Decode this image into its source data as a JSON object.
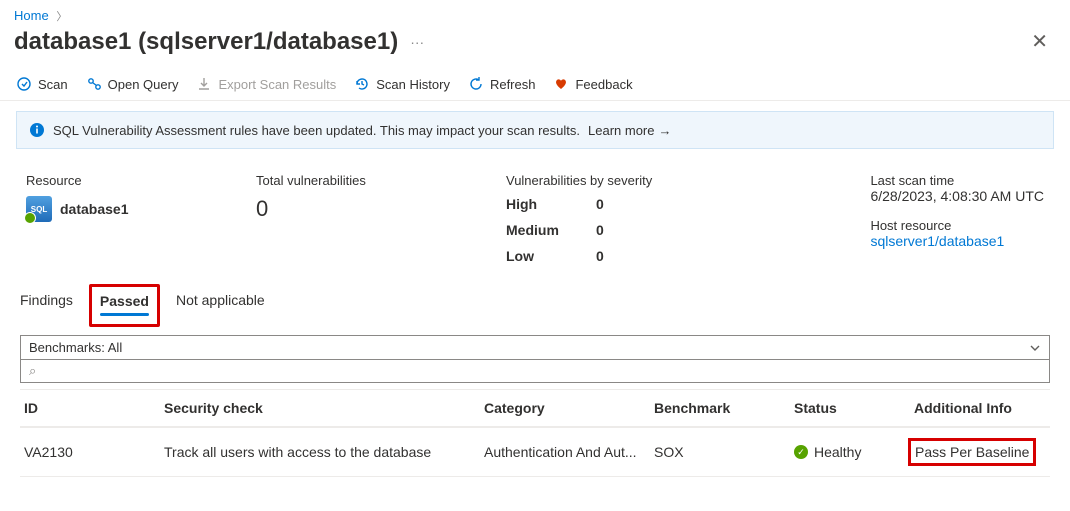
{
  "breadcrumb": {
    "home": "Home"
  },
  "title": "database1 (sqlserver1/database1)",
  "toolbar": {
    "scan": "Scan",
    "open_query": "Open Query",
    "export": "Export Scan Results",
    "history": "Scan History",
    "refresh": "Refresh",
    "feedback": "Feedback"
  },
  "info_bar": {
    "text": "SQL Vulnerability Assessment rules have been updated. This may impact your scan results.",
    "link": "Learn more"
  },
  "stats": {
    "resource_label": "Resource",
    "resource_name": "database1",
    "total_label": "Total vulnerabilities",
    "total_value": "0",
    "sev_label": "Vulnerabilities by severity",
    "high_k": "High",
    "high_v": "0",
    "med_k": "Medium",
    "med_v": "0",
    "low_k": "Low",
    "low_v": "0",
    "last_scan_label": "Last scan time",
    "last_scan_value": "6/28/2023, 4:08:30 AM UTC",
    "host_label": "Host resource",
    "host_value": "sqlserver1/database1"
  },
  "tabs": {
    "findings": "Findings",
    "passed": "Passed",
    "na": "Not applicable"
  },
  "filter": {
    "benchmarks": "Benchmarks: All"
  },
  "search_glyph": "⌕",
  "columns": {
    "id": "ID",
    "check": "Security check",
    "category": "Category",
    "benchmark": "Benchmark",
    "status": "Status",
    "addinfo": "Additional Info"
  },
  "rows": [
    {
      "id": "VA2130",
      "check": "Track all users with access to the database",
      "category": "Authentication And Aut...",
      "benchmark": "SOX",
      "status": "Healthy",
      "addinfo": "Pass Per Baseline"
    }
  ]
}
